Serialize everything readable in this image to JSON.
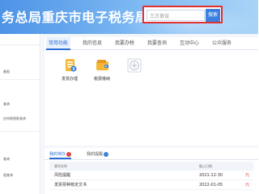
{
  "header": {
    "title": "务总局重庆市电子税务局",
    "search": {
      "placeholder": "",
      "value": "三方协议",
      "button_label": "搜索"
    }
  },
  "sidebar": {
    "items": [
      {
        "label": ""
      },
      {
        "label": "备报"
      },
      {
        "label": ""
      },
      {
        "label": "查询"
      },
      {
        "label": "应申报税款查询"
      },
      {
        "label": ""
      },
      {
        "label": "查询"
      },
      {
        "label": "银查询"
      }
    ]
  },
  "main_tabs": [
    {
      "label": "常用功能",
      "active": true
    },
    {
      "label": "我的信息",
      "active": false
    },
    {
      "label": "我要办税",
      "active": false
    },
    {
      "label": "我要查询",
      "active": false
    },
    {
      "label": "互动中心",
      "active": false
    },
    {
      "label": "公众服务",
      "active": false
    }
  ],
  "functions": [
    {
      "label": "发票办理",
      "icon": "invoice-icon"
    },
    {
      "label": "税费缴纳",
      "icon": "tax-payment-icon"
    },
    {
      "label": "",
      "icon": "add-function-icon"
    }
  ],
  "messages": {
    "tabs": [
      {
        "label": "我的待办",
        "active": true
      },
      {
        "label": "我的提醒",
        "active": false
      }
    ],
    "columns": {
      "name": "事项名称",
      "deadline": "截止日期"
    },
    "rows": [
      {
        "name": "风险提醒",
        "deadline": "2021-12-30",
        "extra": "元"
      },
      {
        "name": "发票票种核定文书",
        "deadline": "2022-01-05",
        "extra": "元"
      }
    ]
  },
  "colors": {
    "accent": "#2b6fd6",
    "header_start": "#4d93e6",
    "header_end": "#a9d4f7",
    "search_highlight": "#e03030"
  }
}
